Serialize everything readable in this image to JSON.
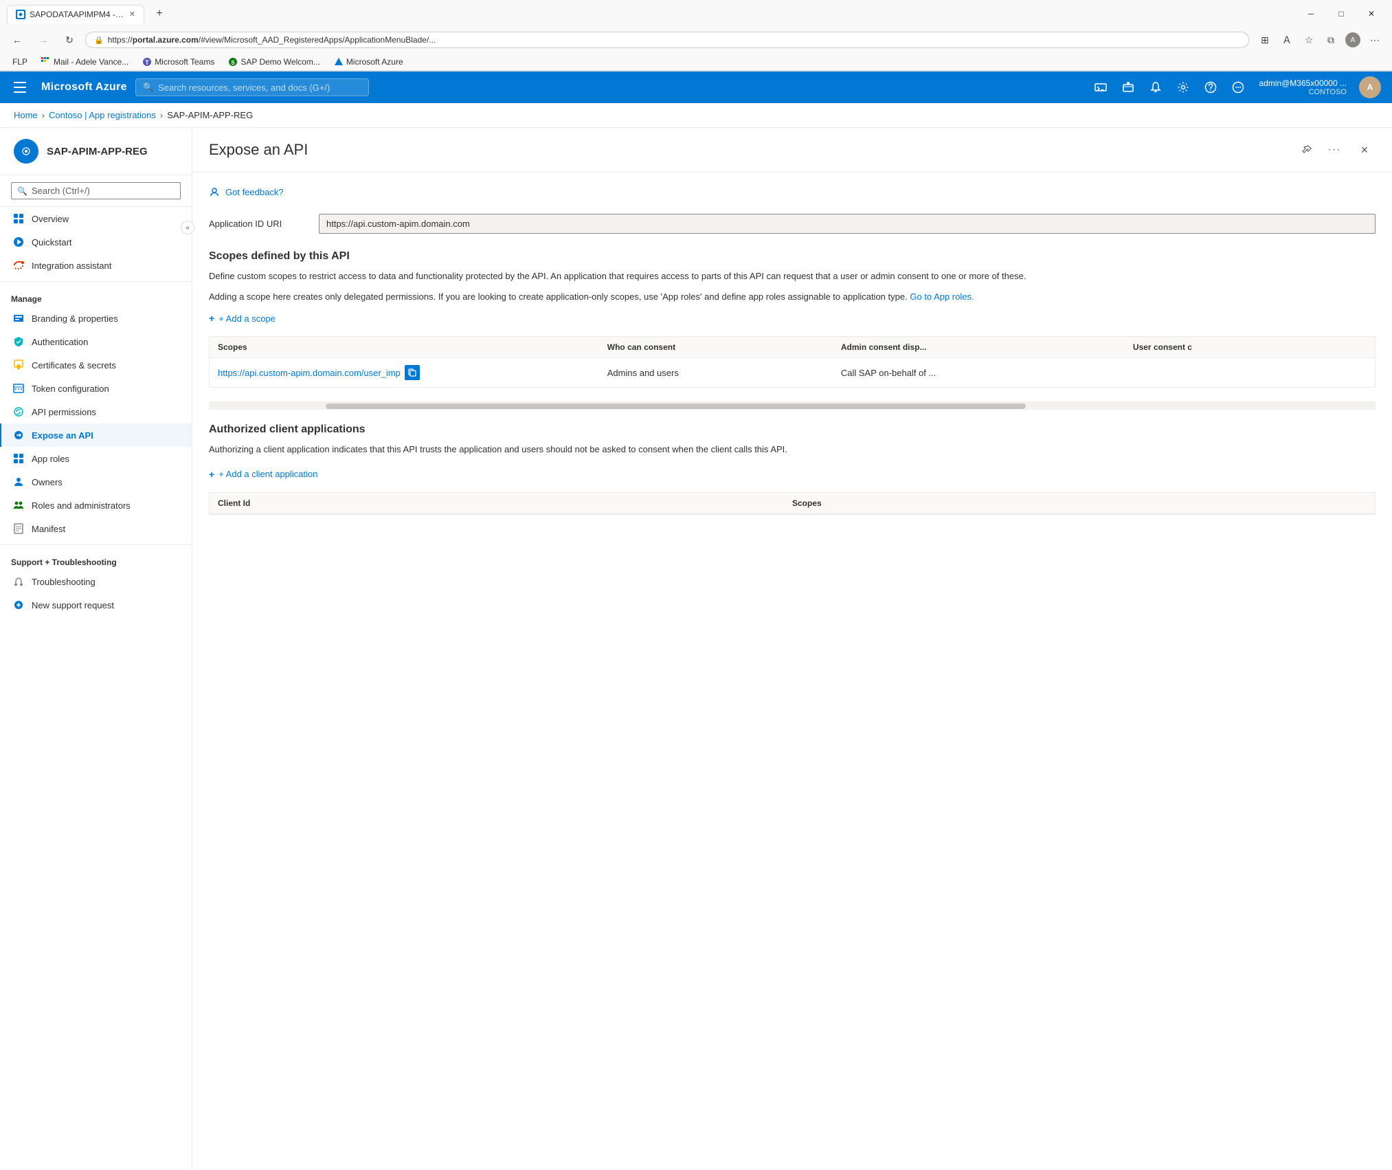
{
  "browser": {
    "tab_title": "SAPODATAAPIMPM4 - Microsof...",
    "url_prefix": "https://",
    "url_domain": "portal.azure.com",
    "url_path": "/#view/Microsoft_AAD_RegisteredApps/ApplicationMenuBlade/...",
    "bookmarks": [
      {
        "id": "flp",
        "label": "FLP",
        "icon": "🏠"
      },
      {
        "id": "mail",
        "label": "Mail - Adele Vance...",
        "icon": "📧",
        "color": "#0078d4"
      },
      {
        "id": "teams",
        "label": "Microsoft Teams",
        "icon": "🟣"
      },
      {
        "id": "sap",
        "label": "SAP Demo Welcom...",
        "icon": "🟢"
      },
      {
        "id": "azure",
        "label": "Microsoft Azure",
        "icon": "🔵"
      }
    ]
  },
  "topbar": {
    "hamburger_label": "Menu",
    "logo": "Microsoft Azure",
    "search_placeholder": "Search resources, services, and docs (G+/)",
    "user_name": "admin@M365x00000 ...",
    "user_org": "CONTOSO"
  },
  "breadcrumb": {
    "items": [
      "Home",
      "Contoso | App registrations",
      "SAP-APIM-APP-REG"
    ]
  },
  "sidebar": {
    "app_name": "SAP-APIM-APP-REG",
    "search_placeholder": "Search (Ctrl+/)",
    "nav_items": [
      {
        "id": "overview",
        "label": "Overview",
        "icon_color": "blue",
        "active": false
      },
      {
        "id": "quickstart",
        "label": "Quickstart",
        "icon_color": "blue",
        "active": false
      },
      {
        "id": "integration",
        "label": "Integration assistant",
        "icon_color": "orange",
        "active": false
      }
    ],
    "manage_label": "Manage",
    "manage_items": [
      {
        "id": "branding",
        "label": "Branding & properties",
        "icon_color": "blue",
        "active": false
      },
      {
        "id": "authentication",
        "label": "Authentication",
        "icon_color": "teal",
        "active": false
      },
      {
        "id": "certificates",
        "label": "Certificates & secrets",
        "icon_color": "yellow",
        "active": false
      },
      {
        "id": "token",
        "label": "Token configuration",
        "icon_color": "blue",
        "active": false
      },
      {
        "id": "api-permissions",
        "label": "API permissions",
        "icon_color": "teal",
        "active": false
      },
      {
        "id": "expose-api",
        "label": "Expose an API",
        "icon_color": "blue",
        "active": true
      },
      {
        "id": "app-roles",
        "label": "App roles",
        "icon_color": "blue",
        "active": false
      },
      {
        "id": "owners",
        "label": "Owners",
        "icon_color": "blue",
        "active": false
      },
      {
        "id": "roles-admin",
        "label": "Roles and administrators",
        "icon_color": "green",
        "active": false
      },
      {
        "id": "manifest",
        "label": "Manifest",
        "icon_color": "gray",
        "active": false
      }
    ],
    "support_label": "Support + Troubleshooting",
    "support_items": [
      {
        "id": "troubleshooting",
        "label": "Troubleshooting",
        "icon_color": "gray",
        "active": false
      },
      {
        "id": "new-support",
        "label": "New support request",
        "icon_color": "blue",
        "active": false
      }
    ]
  },
  "panel": {
    "title": "Expose an API",
    "pin_label": "Pin",
    "more_label": "More options",
    "close_label": "Close",
    "feedback_label": "Got feedback?",
    "app_id_uri_label": "Application ID URI",
    "app_id_uri_value": "https://api.custom-apim.domain.com",
    "scopes_section": {
      "title": "Scopes defined by this API",
      "desc1": "Define custom scopes to restrict access to data and functionality protected by the API. An application that requires access to parts of this API can request that a user or admin consent to one or more of these.",
      "desc2": "Adding a scope here creates only delegated permissions. If you are looking to create application-only scopes, use 'App roles' and define app roles assignable to application type.",
      "link_text": "Go to App roles.",
      "add_scope_label": "+ Add a scope",
      "table_headers": [
        "Scopes",
        "Who can consent",
        "Admin consent disp...",
        "User consent c"
      ],
      "table_rows": [
        {
          "scope": "https://api.custom-apim.domain.com/user_imp",
          "consent": "Admins and users",
          "admin_display": "Call SAP on-behalf of ...",
          "user_consent": ""
        }
      ]
    },
    "authorized_section": {
      "title": "Authorized client applications",
      "desc": "Authorizing a client application indicates that this API trusts the application and users should not be asked to consent when the client calls this API.",
      "add_client_label": "+ Add a client application",
      "table_headers": [
        "Client Id",
        "Scopes"
      ]
    }
  },
  "icons": {
    "search": "🔍",
    "feedback": "👤",
    "pin": "📌",
    "more": "···",
    "close": "✕",
    "add": "+",
    "copy": "📋",
    "back": "←",
    "forward": "→",
    "refresh": "↻",
    "lock": "🔒"
  }
}
